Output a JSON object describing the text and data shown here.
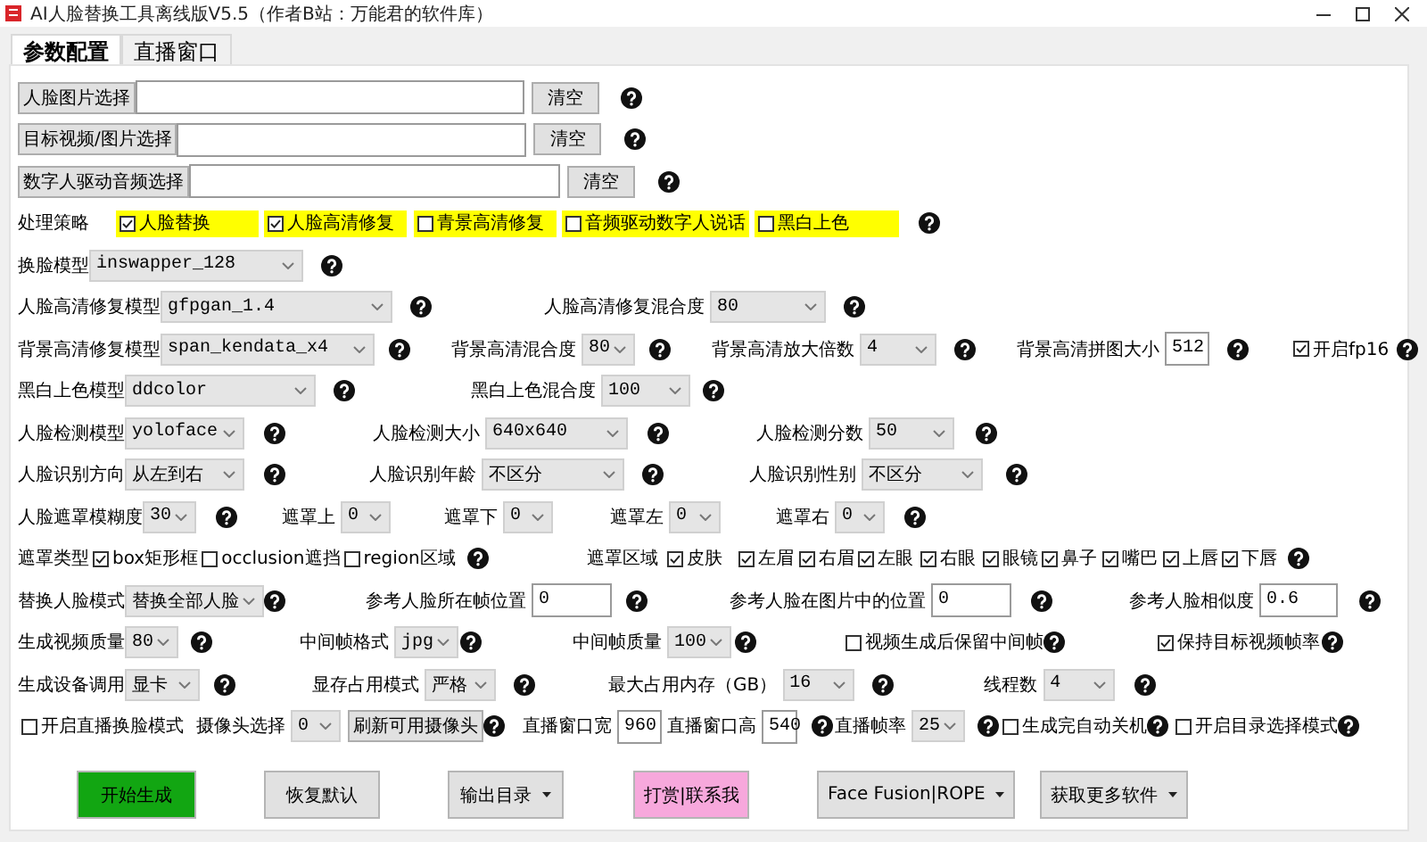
{
  "window": {
    "title": "AI人脸替换工具离线版V5.5（作者B站：万能君的软件库）"
  },
  "tabs": [
    {
      "label": "参数配置",
      "selected": true
    },
    {
      "label": "直播窗口",
      "selected": false
    }
  ],
  "rows": [
    {
      "items": [
        {
          "kind": "button",
          "text": "人脸图片选择"
        },
        {
          "kind": "input"
        },
        {
          "kind": "button",
          "text": "清空"
        },
        {
          "kind": "help"
        }
      ]
    },
    {
      "items": [
        {
          "kind": "button",
          "text": "目标视频/图片选择"
        },
        {
          "kind": "input"
        },
        {
          "kind": "button",
          "text": "清空"
        },
        {
          "kind": "help"
        }
      ]
    },
    {
      "items": [
        {
          "kind": "button",
          "text": "数字人驱动音频选择"
        },
        {
          "kind": "input"
        },
        {
          "kind": "button",
          "text": "清空"
        },
        {
          "kind": "help"
        }
      ]
    },
    {
      "items": [
        {
          "kind": "label",
          "text": "处理策略"
        },
        {
          "kind": "highlight",
          "text": "人脸替换",
          "checked": true
        },
        {
          "kind": "highlight",
          "text": "人脸高清修复",
          "checked": true
        },
        {
          "kind": "highlight",
          "text": "青景高清修复",
          "checked": false
        },
        {
          "kind": "highlight",
          "text": "音频驱动数字人说话",
          "checked": false
        },
        {
          "kind": "highlight",
          "text": "黑白上色",
          "checked": false
        },
        {
          "kind": "help"
        }
      ]
    },
    {
      "items": [
        {
          "kind": "label",
          "text": "换脸模型"
        },
        {
          "kind": "select",
          "value": "inswapper_128"
        },
        {
          "kind": "help"
        }
      ]
    },
    {
      "items": [
        {
          "kind": "label",
          "text": "人脸高清修复模型"
        },
        {
          "kind": "select",
          "value": "gfpgan_1.4"
        },
        {
          "kind": "help"
        },
        {
          "kind": "label",
          "text": "人脸高清修复混合度"
        },
        {
          "kind": "select",
          "value": "80"
        },
        {
          "kind": "help"
        }
      ]
    },
    {
      "items": [
        {
          "kind": "label",
          "text": "背景高清修复模型"
        },
        {
          "kind": "select",
          "value": "span_kendata_x4"
        },
        {
          "kind": "help"
        },
        {
          "kind": "label",
          "text": "背景高清混合度"
        },
        {
          "kind": "select",
          "value": "80"
        },
        {
          "kind": "help"
        },
        {
          "kind": "label",
          "text": "背景高清放大倍数"
        },
        {
          "kind": "select",
          "value": "4"
        },
        {
          "kind": "help"
        },
        {
          "kind": "label",
          "text": "背景高清拼图大小"
        },
        {
          "kind": "input",
          "value": "512"
        },
        {
          "kind": "help"
        },
        {
          "kind": "checkbox",
          "text": "开启fp16",
          "checked": true
        },
        {
          "kind": "help"
        }
      ]
    },
    {
      "items": [
        {
          "kind": "label",
          "text": "黑白上色模型"
        },
        {
          "kind": "select",
          "value": "ddcolor"
        },
        {
          "kind": "help"
        },
        {
          "kind": "label",
          "text": "黑白上色混合度"
        },
        {
          "kind": "select",
          "value": "100"
        },
        {
          "kind": "help"
        }
      ]
    },
    {
      "items": [
        {
          "kind": "label",
          "text": "人脸检测模型"
        },
        {
          "kind": "select",
          "value": "yoloface"
        },
        {
          "kind": "help"
        },
        {
          "kind": "label",
          "text": "人脸检测大小"
        },
        {
          "kind": "select",
          "value": "640x640"
        },
        {
          "kind": "help"
        },
        {
          "kind": "label",
          "text": "人脸检测分数"
        },
        {
          "kind": "select",
          "value": "50"
        },
        {
          "kind": "help"
        }
      ]
    },
    {
      "items": [
        {
          "kind": "label",
          "text": "人脸识别方向"
        },
        {
          "kind": "select",
          "value": "从左到右"
        },
        {
          "kind": "help"
        },
        {
          "kind": "label",
          "text": "人脸识别年龄"
        },
        {
          "kind": "select",
          "value": "不区分"
        },
        {
          "kind": "help"
        },
        {
          "kind": "label",
          "text": "人脸识别性别"
        },
        {
          "kind": "select",
          "value": "不区分"
        },
        {
          "kind": "help"
        }
      ]
    },
    {
      "items": [
        {
          "kind": "label",
          "text": "人脸遮罩模糊度"
        },
        {
          "kind": "select",
          "value": "30"
        },
        {
          "kind": "help"
        },
        {
          "kind": "label",
          "text": "遮罩上"
        },
        {
          "kind": "select",
          "value": "0"
        },
        {
          "kind": "label",
          "text": "遮罩下"
        },
        {
          "kind": "select",
          "value": "0"
        },
        {
          "kind": "label",
          "text": "遮罩左"
        },
        {
          "kind": "select",
          "value": "0"
        },
        {
          "kind": "label",
          "text": "遮罩右"
        },
        {
          "kind": "select",
          "value": "0"
        },
        {
          "kind": "help"
        }
      ]
    },
    {
      "items": [
        {
          "kind": "label",
          "text": "遮罩类型"
        },
        {
          "kind": "checkbox",
          "text": "box矩形框",
          "checked": true
        },
        {
          "kind": "checkbox",
          "text": "occlusion遮挡",
          "checked": false
        },
        {
          "kind": "checkbox",
          "text": "region区域",
          "checked": false
        },
        {
          "kind": "help"
        },
        {
          "kind": "label",
          "text": "遮罩区域"
        },
        {
          "kind": "checkbox",
          "text": "皮肤",
          "checked": true
        },
        {
          "kind": "checkbox",
          "text": "左眉",
          "checked": true
        },
        {
          "kind": "checkbox",
          "text": "右眉",
          "checked": true
        },
        {
          "kind": "checkbox",
          "text": "左眼",
          "checked": true
        },
        {
          "kind": "checkbox",
          "text": "右眼",
          "checked": true
        },
        {
          "kind": "checkbox",
          "text": "眼镜",
          "checked": true
        },
        {
          "kind": "checkbox",
          "text": "鼻子",
          "checked": true
        },
        {
          "kind": "checkbox",
          "text": "嘴巴",
          "checked": true
        },
        {
          "kind": "checkbox",
          "text": "上唇",
          "checked": true
        },
        {
          "kind": "checkbox",
          "text": "下唇",
          "checked": true
        },
        {
          "kind": "help"
        }
      ]
    },
    {
      "items": [
        {
          "kind": "label",
          "text": "替换人脸模式"
        },
        {
          "kind": "select",
          "value": "替换全部人脸"
        },
        {
          "kind": "help"
        },
        {
          "kind": "label",
          "text": "参考人脸所在帧位置"
        },
        {
          "kind": "input",
          "value": "0"
        },
        {
          "kind": "help"
        },
        {
          "kind": "label",
          "text": "参考人脸在图片中的位置"
        },
        {
          "kind": "input",
          "value": "0"
        },
        {
          "kind": "help"
        },
        {
          "kind": "label",
          "text": "参考人脸相似度"
        },
        {
          "kind": "input",
          "value": "0.6"
        },
        {
          "kind": "help"
        }
      ]
    },
    {
      "items": [
        {
          "kind": "label",
          "text": "生成视频质量"
        },
        {
          "kind": "select",
          "value": "80"
        },
        {
          "kind": "help"
        },
        {
          "kind": "label",
          "text": "中间帧格式"
        },
        {
          "kind": "select",
          "value": "jpg"
        },
        {
          "kind": "help"
        },
        {
          "kind": "label",
          "text": "中间帧质量"
        },
        {
          "kind": "select",
          "value": "100"
        },
        {
          "kind": "help"
        },
        {
          "kind": "checkbox",
          "text": "视频生成后保留中间帧",
          "checked": false
        },
        {
          "kind": "help"
        },
        {
          "kind": "checkbox",
          "text": "保持目标视频帧率",
          "checked": true
        },
        {
          "kind": "help"
        }
      ]
    },
    {
      "items": [
        {
          "kind": "label",
          "text": "生成设备调用"
        },
        {
          "kind": "select",
          "value": "显卡"
        },
        {
          "kind": "help"
        },
        {
          "kind": "label",
          "text": "显存占用模式"
        },
        {
          "kind": "select",
          "value": "严格"
        },
        {
          "kind": "help"
        },
        {
          "kind": "label",
          "text": "最大占用内存（GB）"
        },
        {
          "kind": "select",
          "value": "16"
        },
        {
          "kind": "help"
        },
        {
          "kind": "label",
          "text": "线程数"
        },
        {
          "kind": "select",
          "value": "4"
        },
        {
          "kind": "help"
        }
      ]
    },
    {
      "items": [
        {
          "kind": "checkbox",
          "text": "开启直播换脸模式",
          "checked": false
        },
        {
          "kind": "label",
          "text": "摄像头选择"
        },
        {
          "kind": "select",
          "value": "0"
        },
        {
          "kind": "button",
          "text": "刷新可用摄像头"
        },
        {
          "kind": "help"
        },
        {
          "kind": "label",
          "text": "直播窗口宽"
        },
        {
          "kind": "input",
          "value": "960"
        },
        {
          "kind": "label",
          "text": "直播窗口高"
        },
        {
          "kind": "input",
          "value": "540"
        },
        {
          "kind": "help"
        },
        {
          "kind": "label",
          "text": "直播帧率"
        },
        {
          "kind": "select",
          "value": "25"
        },
        {
          "kind": "help"
        },
        {
          "kind": "checkbox",
          "text": "生成完自动关机",
          "checked": false
        },
        {
          "kind": "help"
        },
        {
          "kind": "checkbox",
          "text": "开启目录选择模式",
          "checked": false
        },
        {
          "kind": "help"
        }
      ]
    }
  ],
  "actions": [
    {
      "text": "开始生成",
      "color": "#12a612",
      "dropdown": false
    },
    {
      "text": "恢复默认",
      "color": "#e1e1e1",
      "dropdown": false
    },
    {
      "text": "输出目录",
      "color": "#e1e1e1",
      "dropdown": true
    },
    {
      "text": "打赏|联系我",
      "color": "#f7a8dc",
      "dropdown": false
    },
    {
      "text": "Face Fusion|ROPE",
      "color": "#e1e1e1",
      "dropdown": true
    },
    {
      "text": "获取更多软件",
      "color": "#e1e1e1",
      "dropdown": true
    }
  ]
}
